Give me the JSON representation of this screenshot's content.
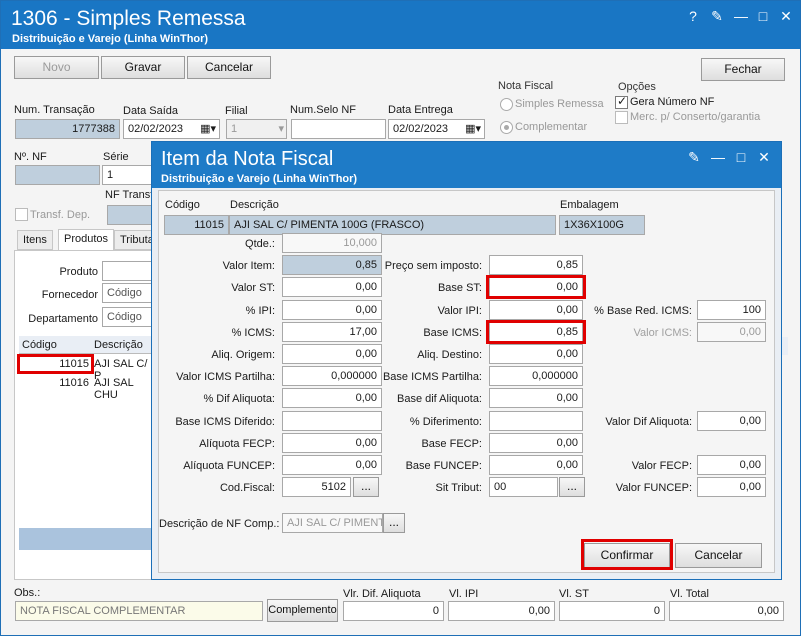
{
  "window": {
    "title": "1306 - Simples Remessa",
    "subtitle": "Distribuição e Varejo (Linha WinThor)",
    "controls": [
      "?",
      "□",
      "✕"
    ]
  },
  "toolbar": {
    "novo": "Novo",
    "gravar": "Gravar",
    "cancelar": "Cancelar",
    "fechar": "Fechar"
  },
  "nota_fiscal": {
    "legend": "Nota Fiscal",
    "simples_remessa": "Simples Remessa",
    "complementar": "Complementar"
  },
  "opcoes": {
    "legend": "Opções",
    "gera_numero_nf": "Gera Número NF",
    "merc_conserto": "Merc. p/ Conserto/garantia"
  },
  "header_fields": {
    "num_transacao_label": "Num. Transação",
    "num_transacao_value": "1777388",
    "data_saida_label": "Data Saída",
    "data_saida_value": "02/02/2023",
    "filial_label": "Filial",
    "filial_value": "1",
    "num_selo_nf_label": "Num.Selo NF",
    "num_selo_nf_value": "",
    "data_entrega_label": "Data Entrega",
    "data_entrega_value": "02/02/2023",
    "num_nf_label": "Nº. NF",
    "serie_label": "Série",
    "serie_value": "1",
    "nf_transf_label": "NF Transf",
    "transf_dep_label": "Transf. Dep."
  },
  "tabs": [
    "Itens",
    "Produtos",
    "Tributa"
  ],
  "produtos_panel": {
    "produto_label": "Produto",
    "fornecedor_label": "Fornecedor",
    "fornecedor_placeholder": "Código",
    "departamento_label": "Departamento",
    "departamento_placeholder": "Código",
    "grid_headers": [
      "Código",
      "Descrição"
    ],
    "rows": [
      {
        "codigo": "11015",
        "descricao": "AJI SAL C/ P"
      },
      {
        "codigo": "11016",
        "descricao": "AJI SAL CHU"
      }
    ]
  },
  "footer": {
    "obs_label": "Obs.:",
    "obs_value": "NOTA FISCAL COMPLEMENTAR",
    "complemento": "Complemento",
    "vl_dif_aliquota_label": "Vlr. Dif. Aliquota",
    "vl_dif_aliquota_value": "0",
    "vl_ipi_label": "Vl. IPI",
    "vl_ipi_value": "0,00",
    "vl_st_label": "Vl. ST",
    "vl_st_value": "0",
    "vl_total_label": "Vl. Total",
    "vl_total_value": "0,00"
  },
  "dialog": {
    "title": "Item da Nota Fiscal",
    "subtitle": "Distribuição e Varejo (Linha WinThor)",
    "codigo_label": "Código",
    "codigo_value": "11015",
    "descricao_label": "Descrição",
    "descricao_value": "AJI SAL C/ PIMENTA 100G (FRASCO)",
    "embalagem_label": "Embalagem",
    "embalagem_value": "1X36X100G",
    "left": [
      {
        "label": "Qtde.:",
        "value": "10,000"
      },
      {
        "label": "Valor Item:",
        "value": "0,85"
      },
      {
        "label": "Valor ST:",
        "value": "0,00"
      },
      {
        "label": "% IPI:",
        "value": "0,00"
      },
      {
        "label": "% ICMS:",
        "value": "17,00"
      },
      {
        "label": "Aliq. Origem:",
        "value": "0,00"
      },
      {
        "label": "Valor ICMS Partilha:",
        "value": "0,000000"
      },
      {
        "label": "% Dif Aliquota:",
        "value": "0,00"
      },
      {
        "label": "Base ICMS Diferido:",
        "value": ""
      },
      {
        "label": "Alíquota FECP:",
        "value": "0,00"
      },
      {
        "label": "Alíquota FUNCEP:",
        "value": "0,00"
      },
      {
        "label": "Cod.Fiscal:",
        "value": "5102"
      }
    ],
    "mid": [
      {
        "label": "Preço sem imposto:",
        "value": "0,85"
      },
      {
        "label": "Base ST:",
        "value": "0,00"
      },
      {
        "label": "Valor IPI:",
        "value": "0,00"
      },
      {
        "label": "Base ICMS:",
        "value": "0,85"
      },
      {
        "label": "Aliq. Destino:",
        "value": "0,00"
      },
      {
        "label": "Base ICMS Partilha:",
        "value": "0,000000"
      },
      {
        "label": "Base dif Aliquota:",
        "value": "0,00"
      },
      {
        "label": "% Diferimento:",
        "value": ""
      },
      {
        "label": "Base FECP:",
        "value": "0,00"
      },
      {
        "label": "Base FUNCEP:",
        "value": "0,00"
      },
      {
        "label": "Sit Tribut:",
        "value": "00"
      }
    ],
    "right": [
      {
        "label": "% Base Red. ICMS:",
        "value": "100"
      },
      {
        "label": "Valor ICMS:",
        "value": "0,00"
      },
      {
        "label": "Valor Dif Aliquota:",
        "value": "0,00"
      },
      {
        "label": "Valor FECP:",
        "value": "0,00"
      },
      {
        "label": "Valor FUNCEP:",
        "value": "0,00"
      }
    ],
    "desc_nf_comp_label": "Descrição de NF Comp.:",
    "desc_nf_comp_value": "AJI SAL C/ PIMENTA",
    "ellipsis": "...",
    "confirmar": "Confirmar",
    "cancelar": "Cancelar"
  }
}
